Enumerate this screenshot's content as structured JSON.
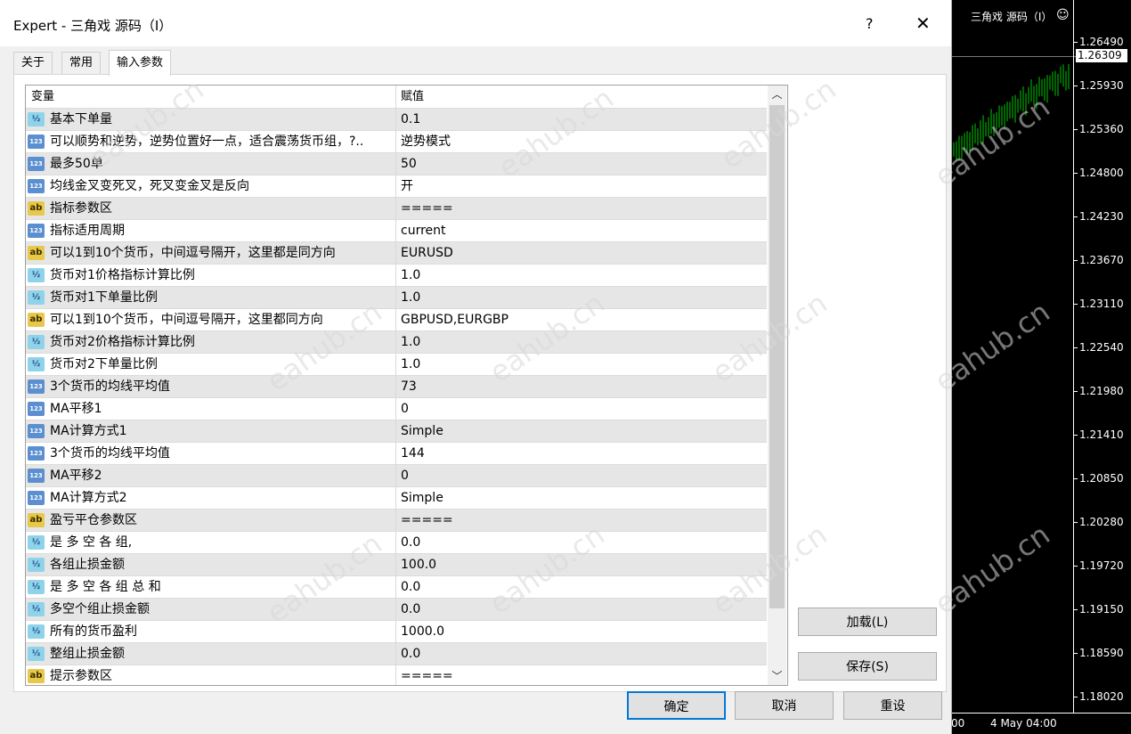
{
  "window": {
    "title": "Expert - 三角戏 源码（I）",
    "help_label": "?",
    "close_label": "✕"
  },
  "tabs": [
    {
      "label": "关于"
    },
    {
      "label": "常用"
    },
    {
      "label": "输入参数",
      "active": true
    }
  ],
  "grid": {
    "columns": {
      "variable": "变量",
      "value": "赋值"
    },
    "rows": [
      {
        "type": "dbl",
        "name": "基本下单量",
        "value": "0.1"
      },
      {
        "type": "num",
        "name": "可以顺势和逆势，逆势位置好一点，适合震荡货币组，?..",
        "value": "逆势模式"
      },
      {
        "type": "num",
        "name": "最多50单",
        "value": "50"
      },
      {
        "type": "num",
        "name": "均线金叉变死叉，死叉变金叉是反向",
        "value": "开"
      },
      {
        "type": "str",
        "name": "指标参数区",
        "value": "====="
      },
      {
        "type": "num",
        "name": "指标适用周期",
        "value": "current"
      },
      {
        "type": "str",
        "name": "可以1到10个货币，中间逗号隔开，这里都是同方向",
        "value": "EURUSD"
      },
      {
        "type": "dbl",
        "name": "货币对1价格指标计算比例",
        "value": "1.0"
      },
      {
        "type": "dbl",
        "name": "货币对1下单量比例",
        "value": "1.0"
      },
      {
        "type": "str",
        "name": "可以1到10个货币，中间逗号隔开，这里都同方向",
        "value": "GBPUSD,EURGBP"
      },
      {
        "type": "dbl",
        "name": "货币对2价格指标计算比例",
        "value": "1.0"
      },
      {
        "type": "dbl",
        "name": "货币对2下单量比例",
        "value": "1.0"
      },
      {
        "type": "num",
        "name": "3个货币的均线平均值",
        "value": "73"
      },
      {
        "type": "num",
        "name": "MA平移1",
        "value": "0"
      },
      {
        "type": "num",
        "name": "MA计算方式1",
        "value": "Simple"
      },
      {
        "type": "num",
        "name": "3个货币的均线平均值",
        "value": "144"
      },
      {
        "type": "num",
        "name": "MA平移2",
        "value": "0"
      },
      {
        "type": "num",
        "name": "MA计算方式2",
        "value": "Simple"
      },
      {
        "type": "str",
        "name": "盈亏平仓参数区",
        "value": "====="
      },
      {
        "type": "dbl",
        "name": "是 多 空 各 组,",
        "value": "0.0"
      },
      {
        "type": "dbl",
        "name": "各组止损金额",
        "value": "100.0"
      },
      {
        "type": "dbl",
        "name": "是 多 空 各 组 总 和",
        "value": "0.0"
      },
      {
        "type": "dbl",
        "name": "多空个组止损金额",
        "value": "0.0"
      },
      {
        "type": "dbl",
        "name": "所有的货币盈利",
        "value": "1000.0"
      },
      {
        "type": "dbl",
        "name": "整组止损金额",
        "value": "0.0"
      },
      {
        "type": "str",
        "name": "提示参数区",
        "value": "====="
      }
    ]
  },
  "icons": {
    "num": "123",
    "str": "ab",
    "dbl": "½"
  },
  "buttons": {
    "load": "加载(L)",
    "save": "保存(S)",
    "ok": "确定",
    "cancel": "取消",
    "reset": "重设"
  },
  "watermark": "eahub.cn",
  "chart": {
    "title": "三角戏 源码（I）",
    "smiley": "☺",
    "current_price": "1.26309",
    "price_labels": [
      "1.26490",
      "1.25930",
      "1.25360",
      "1.24800",
      "1.24230",
      "1.23670",
      "1.23110",
      "1.22540",
      "1.21980",
      "1.21410",
      "1.20850",
      "1.20280",
      "1.19720",
      "1.19150",
      "1.18590",
      "1.18020"
    ],
    "time_label": "4 May 04:00",
    "time_label_left": "00",
    "candle_color": "#00c800"
  }
}
